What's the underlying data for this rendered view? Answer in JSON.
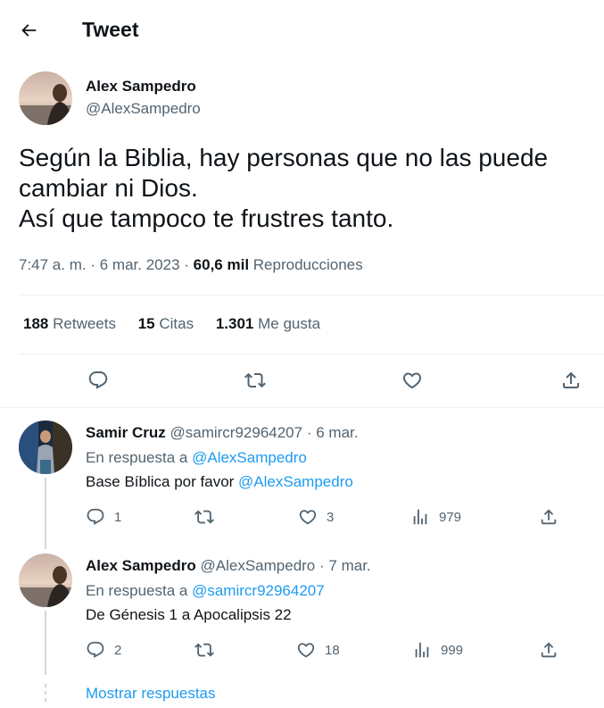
{
  "header": {
    "title": "Tweet",
    "back_icon": "arrow-left-icon"
  },
  "tweet": {
    "author_name": "Alex Sampedro",
    "author_handle": "@AlexSampedro",
    "text_lines": [
      "Según la Biblia, hay personas que no las puede",
      "cambiar ni Dios.",
      "Así que tampoco te frustres tanto."
    ],
    "time": "7:47 a. m.",
    "dot": "·",
    "date": "6 mar. 2023",
    "views_count": "60,6 mil",
    "views_label": "Reproducciones",
    "retweets_count": "188",
    "retweets_label": "Retweets",
    "quotes_count": "15",
    "quotes_label": "Citas",
    "likes_count": "1.301",
    "likes_label": "Me gusta"
  },
  "replies": [
    {
      "name": "Samir Cruz",
      "handle": "@samircr92964207",
      "date": "6 mar.",
      "reply_prefix": "En respuesta a",
      "reply_to": "@AlexSampedro",
      "text": "Base Bíblica por favor",
      "mention": "@AlexSampedro",
      "replies": "1",
      "retweets": "",
      "likes": "3",
      "views": "979"
    },
    {
      "name": "Alex Sampedro",
      "handle": "@AlexSampedro",
      "date": "7 mar.",
      "reply_prefix": "En respuesta a",
      "reply_to": "@samircr92964207",
      "text": "De Génesis 1 a Apocalipsis 22",
      "mention": "",
      "replies": "2",
      "retweets": "",
      "likes": "18",
      "views": "999"
    }
  ],
  "show_replies": "Mostrar respuestas",
  "colors": {
    "accent": "#1d9bf0",
    "text": "#0f1419",
    "muted": "#536471",
    "border": "#eff3f4"
  }
}
